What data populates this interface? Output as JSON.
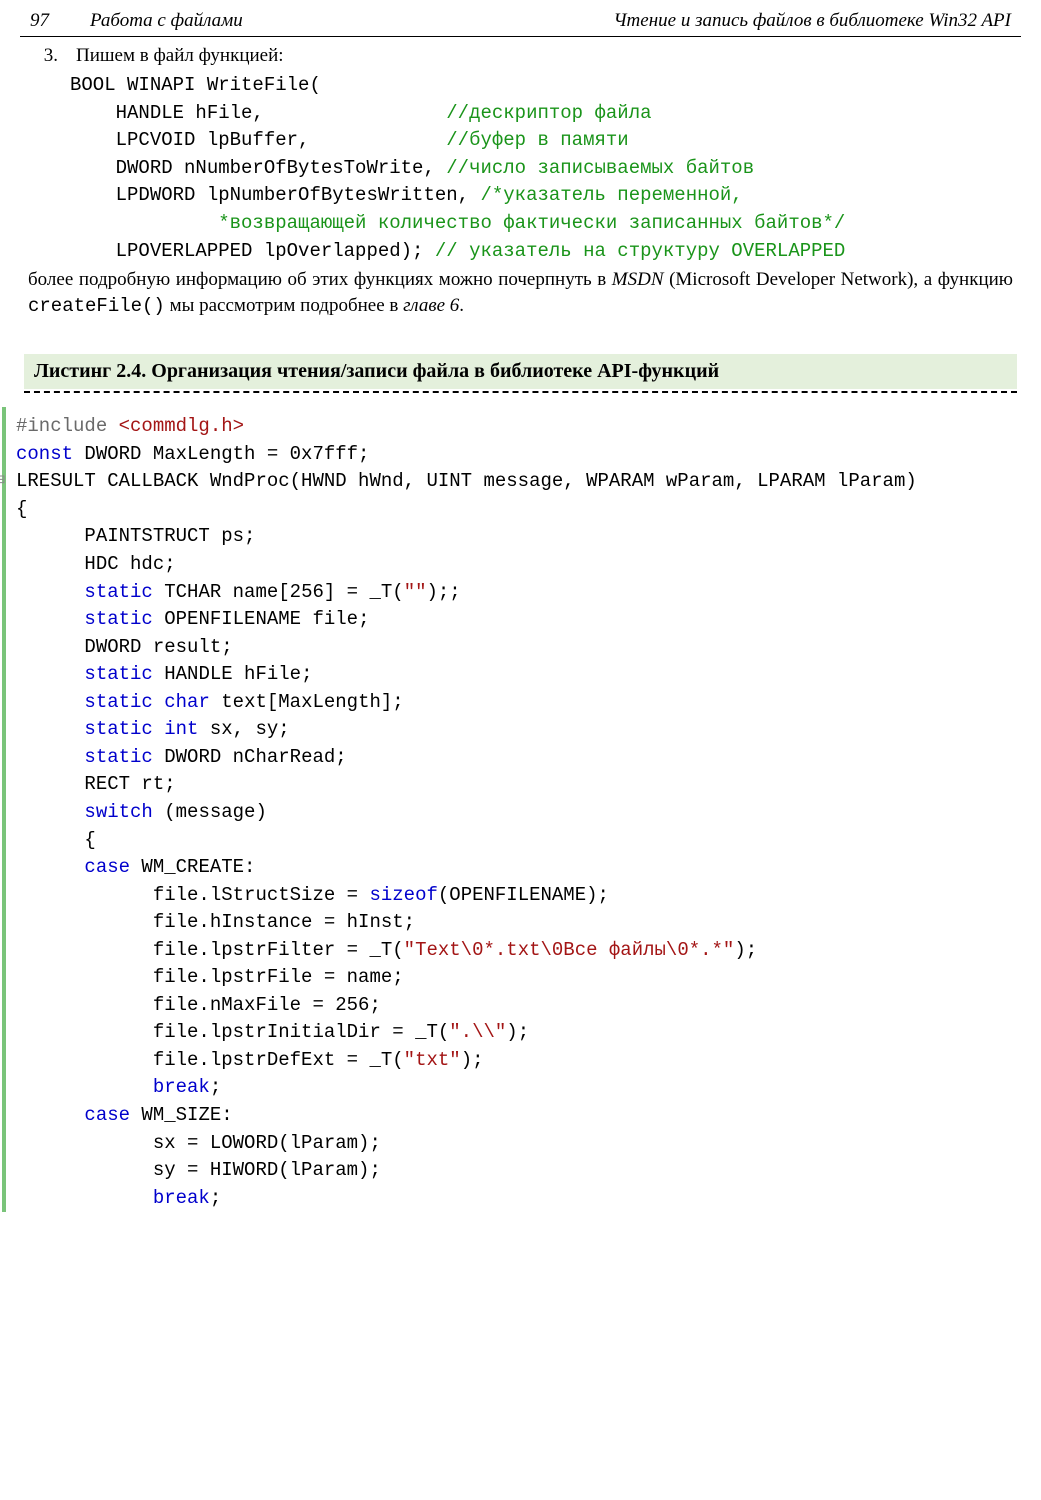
{
  "header": {
    "page_number": "97",
    "left_title": "Работа с файлами",
    "right_title": "Чтение и запись файлов в библиотеке Win32 API"
  },
  "step3": {
    "num": "3.",
    "intro": "Пишем в файл функцией:",
    "fn": {
      "l1": "BOOL WINAPI WriteFile(",
      "l2a": "    HANDLE hFile,                ",
      "l2c": "//дескриптор файла",
      "l3a": "    LPCVOID lpBuffer,            ",
      "l3c": "//буфер в памяти",
      "l4a": "    DWORD nNumberOfBytesToWrite, ",
      "l4c": "//число записываемых байтов",
      "l5a": "    LPDWORD lpNumberOfBytesWritten, ",
      "l5c": "/*указатель переменной,",
      "l6c": "             *возвращающей количество фактически записанных байтов*/",
      "l7a": "    LPOVERLAPPED lpOverlapped); ",
      "l7c": "// указатель на структуру OVERLAPPED"
    }
  },
  "para_parts": {
    "p1": "более подробную информацию об этих функциях можно почерпнуть в ",
    "msdn": "MSDN",
    "p2": " (Microsoft Developer Network), а функцию ",
    "createfile": "createFile()",
    "p3": " мы рассмотрим подробнее в ",
    "chap": "главе 6",
    "p4": "."
  },
  "listing": {
    "title": "Листинг 2.4. Организация чтения/записи файла в библиотеке API-функций"
  },
  "code": {
    "l01a": "#include",
    "l01b": " <commdlg.h>",
    "l02a": "const",
    "l02b": " DWORD MaxLength = 0x7fff;",
    "l03": "LRESULT CALLBACK WndProc(HWND hWnd, UINT message, WPARAM wParam, LPARAM lParam)",
    "l04": "{",
    "l05": "      PAINTSTRUCT ps;",
    "l06": "      HDC hdc;",
    "l07a": "      ",
    "l07b": "static",
    "l07c": " TCHAR name[256] = _T(",
    "l07d": "\"\"",
    "l07e": ");;",
    "l08a": "      ",
    "l08b": "static",
    "l08c": " OPENFILENAME file;",
    "l09": "      DWORD result;",
    "l10a": "      ",
    "l10b": "static",
    "l10c": " HANDLE hFile;",
    "l11a": "      ",
    "l11b": "static",
    "l11c": " ",
    "l11d": "char",
    "l11e": " text[MaxLength];",
    "l12a": "      ",
    "l12b": "static",
    "l12c": " ",
    "l12d": "int",
    "l12e": " sx, sy;",
    "l13a": "      ",
    "l13b": "static",
    "l13c": " DWORD nCharRead;",
    "l14": "      RECT rt;",
    "l15a": "      ",
    "l15b": "switch",
    "l15c": " (message)",
    "l16": "      {",
    "l17a": "      ",
    "l17b": "case",
    "l17c": " WM_CREATE:",
    "l18a": "            file.lStructSize = ",
    "l18b": "sizeof",
    "l18c": "(OPENFILENAME);",
    "l19": "            file.hInstance = hInst;",
    "l20a": "            file.lpstrFilter = _T(",
    "l20b": "\"Text\\0*.txt\\0Все файлы\\0*.*\"",
    "l20c": ");",
    "l21": "            file.lpstrFile = name;",
    "l22": "            file.nMaxFile = 256;",
    "l23a": "            file.lpstrInitialDir = _T(",
    "l23b": "\".\\\\\"",
    "l23c": ");",
    "l24a": "            file.lpstrDefExt = _T(",
    "l24b": "\"txt\"",
    "l24c": ");",
    "l25a": "            ",
    "l25b": "break",
    "l25c": ";",
    "l26a": "      ",
    "l26b": "case",
    "l26c": " WM_SIZE:",
    "l27": "            sx = LOWORD(lParam);",
    "l28": "            sy = HIWORD(lParam);",
    "l29a": "            ",
    "l29b": "break",
    "l29c": ";"
  }
}
